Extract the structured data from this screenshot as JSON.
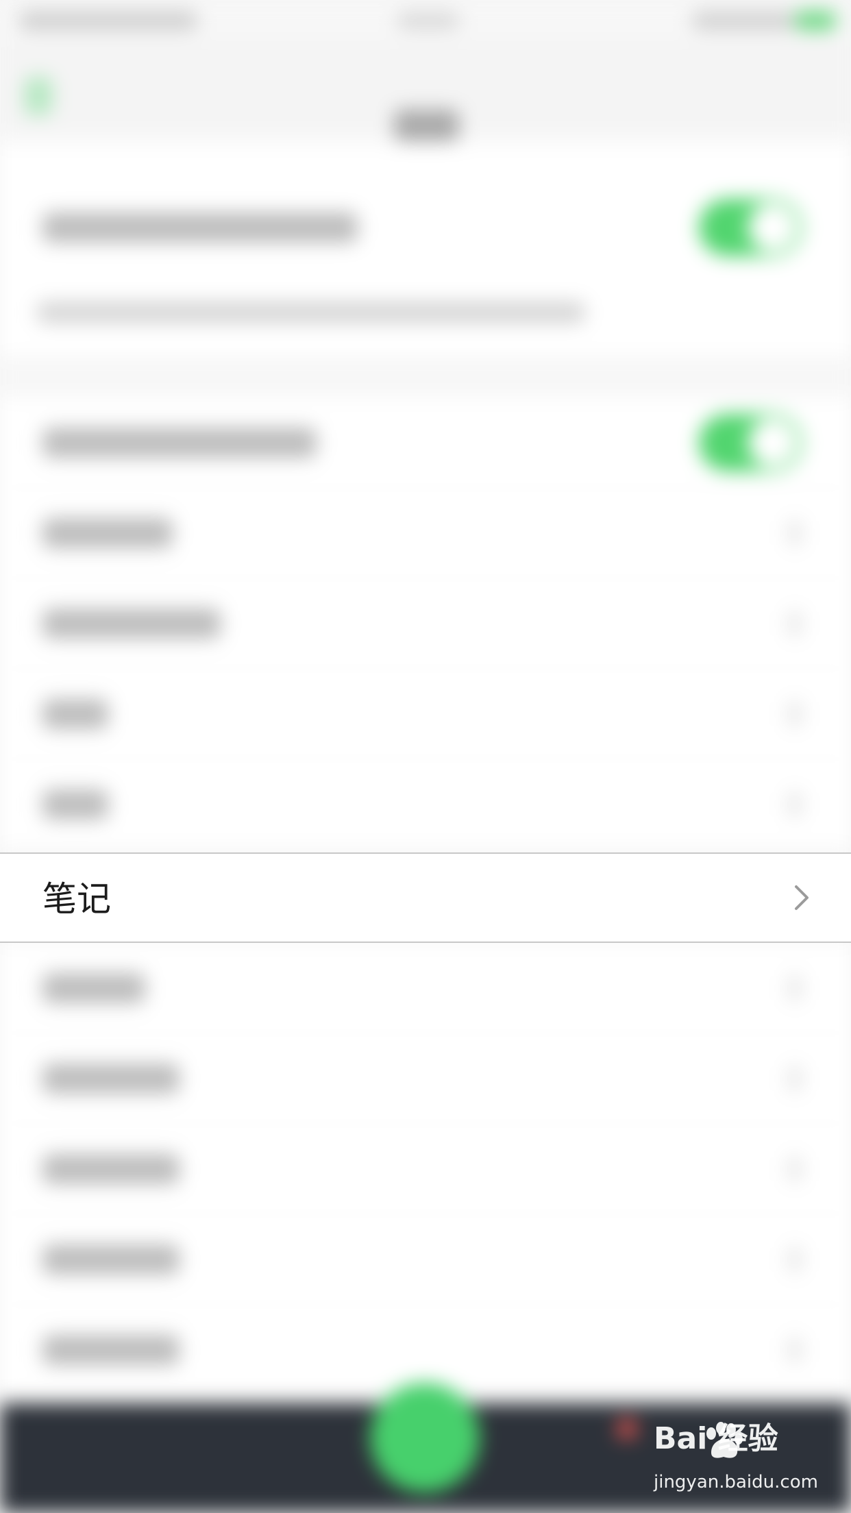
{
  "settings_list": {
    "highlighted_item": {
      "label": "笔记"
    }
  },
  "watermark": {
    "logo_text": "Bai  经验",
    "url": "jingyan.baidu.com"
  },
  "colors": {
    "toggle_on": "#52d56f",
    "tab_bar": "#2d323a",
    "fab": "#47d06c"
  },
  "icons": {
    "row_chevron": "chevron-right-icon"
  }
}
